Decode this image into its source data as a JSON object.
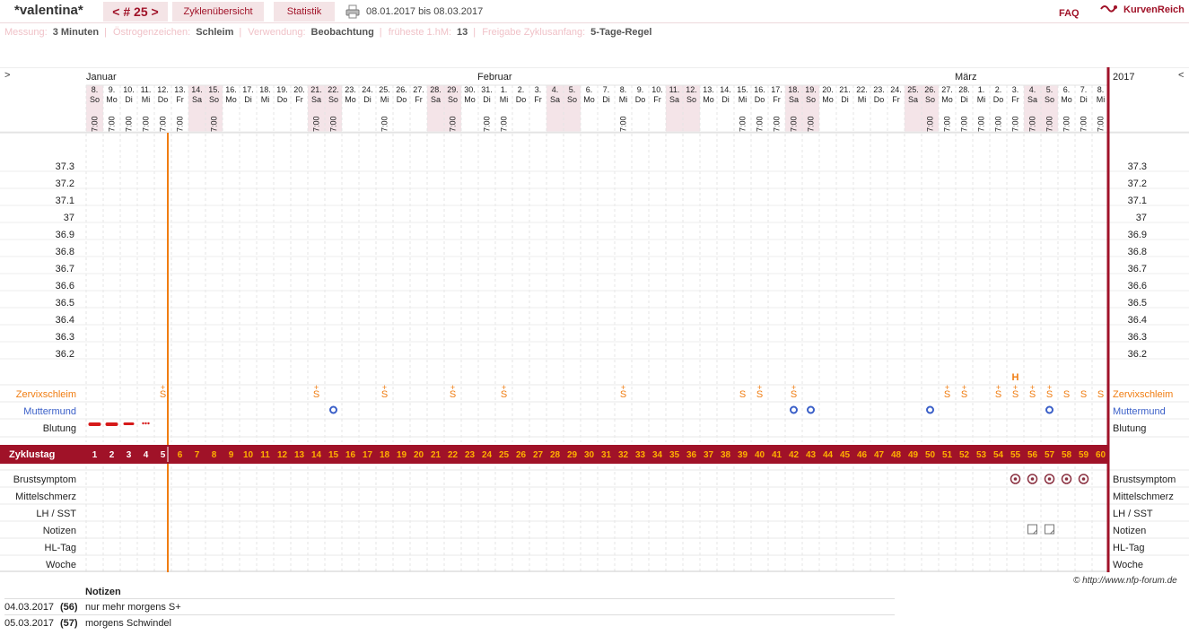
{
  "header": {
    "title": "*valentina*",
    "cycle_tab": "< # 25 >",
    "overview_tab": "Zyklenübersicht",
    "stats_tab": "Statistik",
    "date_range": "08.01.2017 bis 08.03.2017",
    "faq": "FAQ",
    "brand": "KurvenReich"
  },
  "info": [
    {
      "label": "Messung:",
      "value": "3 Minuten"
    },
    {
      "label": "Östrogenzeichen:",
      "value": "Schleim"
    },
    {
      "label": "Verwendung:",
      "value": "Beobachtung"
    },
    {
      "label": "früheste 1.hM:",
      "value": "13"
    },
    {
      "label": "Freigabe Zyklusanfang:",
      "value": "5-Tage-Regel"
    }
  ],
  "chart_data": {
    "type": "table",
    "year": "2017",
    "nav_prev": ">",
    "nav_next": "<",
    "months": [
      {
        "name": "Januar",
        "start_index": 0
      },
      {
        "name": "Februar",
        "start_index": 24
      },
      {
        "name": "März",
        "start_index": 52
      }
    ],
    "days": [
      {
        "d": "8.",
        "w": "So",
        "t": "7:00"
      },
      {
        "d": "9.",
        "w": "Mo",
        "t": "7:00"
      },
      {
        "d": "10.",
        "w": "Di",
        "t": "7:00"
      },
      {
        "d": "11.",
        "w": "Mi",
        "t": "7:00"
      },
      {
        "d": "12.",
        "w": "Do",
        "t": "7:00"
      },
      {
        "d": "13.",
        "w": "Fr",
        "t": "7:00"
      },
      {
        "d": "14.",
        "w": "Sa",
        "t": ""
      },
      {
        "d": "15.",
        "w": "So",
        "t": "7:00"
      },
      {
        "d": "16.",
        "w": "Mo",
        "t": ""
      },
      {
        "d": "17.",
        "w": "Di",
        "t": ""
      },
      {
        "d": "18.",
        "w": "Mi",
        "t": ""
      },
      {
        "d": "19.",
        "w": "Do",
        "t": ""
      },
      {
        "d": "20.",
        "w": "Fr",
        "t": ""
      },
      {
        "d": "21.",
        "w": "Sa",
        "t": "7:00"
      },
      {
        "d": "22.",
        "w": "So",
        "t": "7:00"
      },
      {
        "d": "23.",
        "w": "Mo",
        "t": ""
      },
      {
        "d": "24.",
        "w": "Di",
        "t": ""
      },
      {
        "d": "25.",
        "w": "Mi",
        "t": "7:00"
      },
      {
        "d": "26.",
        "w": "Do",
        "t": ""
      },
      {
        "d": "27.",
        "w": "Fr",
        "t": ""
      },
      {
        "d": "28.",
        "w": "Sa",
        "t": ""
      },
      {
        "d": "29.",
        "w": "So",
        "t": "7:00"
      },
      {
        "d": "30.",
        "w": "Mo",
        "t": ""
      },
      {
        "d": "31.",
        "w": "Di",
        "t": "7:00"
      },
      {
        "d": "1.",
        "w": "Mi",
        "t": "7:00"
      },
      {
        "d": "2.",
        "w": "Do",
        "t": ""
      },
      {
        "d": "3.",
        "w": "Fr",
        "t": ""
      },
      {
        "d": "4.",
        "w": "Sa",
        "t": ""
      },
      {
        "d": "5.",
        "w": "So",
        "t": ""
      },
      {
        "d": "6.",
        "w": "Mo",
        "t": ""
      },
      {
        "d": "7.",
        "w": "Di",
        "t": ""
      },
      {
        "d": "8.",
        "w": "Mi",
        "t": "7:00"
      },
      {
        "d": "9.",
        "w": "Do",
        "t": ""
      },
      {
        "d": "10.",
        "w": "Fr",
        "t": ""
      },
      {
        "d": "11.",
        "w": "Sa",
        "t": ""
      },
      {
        "d": "12.",
        "w": "So",
        "t": ""
      },
      {
        "d": "13.",
        "w": "Mo",
        "t": ""
      },
      {
        "d": "14.",
        "w": "Di",
        "t": ""
      },
      {
        "d": "15.",
        "w": "Mi",
        "t": "7:00"
      },
      {
        "d": "16.",
        "w": "Do",
        "t": "7:00"
      },
      {
        "d": "17.",
        "w": "Fr",
        "t": "7:00"
      },
      {
        "d": "18.",
        "w": "Sa",
        "t": "7:00"
      },
      {
        "d": "19.",
        "w": "So",
        "t": "7:00"
      },
      {
        "d": "20.",
        "w": "Mo",
        "t": ""
      },
      {
        "d": "21.",
        "w": "Di",
        "t": ""
      },
      {
        "d": "22.",
        "w": "Mi",
        "t": ""
      },
      {
        "d": "23.",
        "w": "Do",
        "t": ""
      },
      {
        "d": "24.",
        "w": "Fr",
        "t": ""
      },
      {
        "d": "25.",
        "w": "Sa",
        "t": ""
      },
      {
        "d": "26.",
        "w": "So",
        "t": "7:00"
      },
      {
        "d": "27.",
        "w": "Mo",
        "t": "7:00"
      },
      {
        "d": "28.",
        "w": "Di",
        "t": "7:00"
      },
      {
        "d": "1.",
        "w": "Mi",
        "t": "7:00"
      },
      {
        "d": "2.",
        "w": "Do",
        "t": "7:00"
      },
      {
        "d": "3.",
        "w": "Fr",
        "t": "7:00"
      },
      {
        "d": "4.",
        "w": "Sa",
        "t": "7:00"
      },
      {
        "d": "5.",
        "w": "So",
        "t": "7:00"
      },
      {
        "d": "6.",
        "w": "Mo",
        "t": "7:00"
      },
      {
        "d": "7.",
        "w": "Di",
        "t": "7:00"
      },
      {
        "d": "8.",
        "w": "Mi",
        "t": "7:00"
      }
    ],
    "temperature_ticks": [
      "37.3",
      "37.2",
      "37.1",
      "37",
      "36.9",
      "36.8",
      "36.7",
      "36.6",
      "36.5",
      "36.4",
      "36.3",
      "36.2"
    ],
    "row_labels": {
      "cervix": "Zervixschleim",
      "mouth": "Muttermund",
      "bleeding": "Blutung",
      "cycle_day": "Zyklustag",
      "breast": "Brustsymptom",
      "mittel": "Mittelschmerz",
      "lh": "LH / SST",
      "notes": "Notizen",
      "hl": "HL-Tag",
      "week": "Woche"
    },
    "cervix_marks": [
      {
        "day": 5,
        "sym": "S+"
      },
      {
        "day": 14,
        "sym": "S+"
      },
      {
        "day": 18,
        "sym": "S+"
      },
      {
        "day": 22,
        "sym": "S+"
      },
      {
        "day": 25,
        "sym": "S+"
      },
      {
        "day": 32,
        "sym": "S+"
      },
      {
        "day": 39,
        "sym": "S"
      },
      {
        "day": 40,
        "sym": "S+"
      },
      {
        "day": 42,
        "sym": "S+"
      },
      {
        "day": 51,
        "sym": "S+"
      },
      {
        "day": 52,
        "sym": "S+"
      },
      {
        "day": 54,
        "sym": "S+"
      },
      {
        "day": 55,
        "sym": "S+"
      },
      {
        "day": 56,
        "sym": "S+"
      },
      {
        "day": 57,
        "sym": "S+"
      },
      {
        "day": 58,
        "sym": "S"
      },
      {
        "day": 59,
        "sym": "S"
      },
      {
        "day": 60,
        "sym": "S"
      }
    ],
    "cervix_extra": [
      {
        "day": 55,
        "sym": "H"
      }
    ],
    "mouth_marks": [
      15,
      42,
      43,
      50,
      57
    ],
    "bleeding": [
      {
        "day": 1,
        "level": "strong"
      },
      {
        "day": 2,
        "level": "strong"
      },
      {
        "day": 3,
        "level": "medium"
      },
      {
        "day": 4,
        "level": "spotting"
      }
    ],
    "cycle_days": 60,
    "cycle_start_marker_after_day": 5,
    "breast_marks": [
      55,
      56,
      57,
      58,
      59
    ],
    "note_marks": [
      56,
      57
    ]
  },
  "copyright": "© http://www.nfp-forum.de",
  "notes": {
    "heading": "Notizen",
    "rows": [
      {
        "date": "04.03.2017",
        "num": "(56)",
        "text": "nur mehr morgens S+"
      },
      {
        "date": "05.03.2017",
        "num": "(57)",
        "text": "morgens Schwindel"
      }
    ]
  },
  "colors": {
    "accent": "#a01228",
    "orange": "#f07d12",
    "blue": "#3a5fc8",
    "weekend": "#f4e4e8"
  }
}
